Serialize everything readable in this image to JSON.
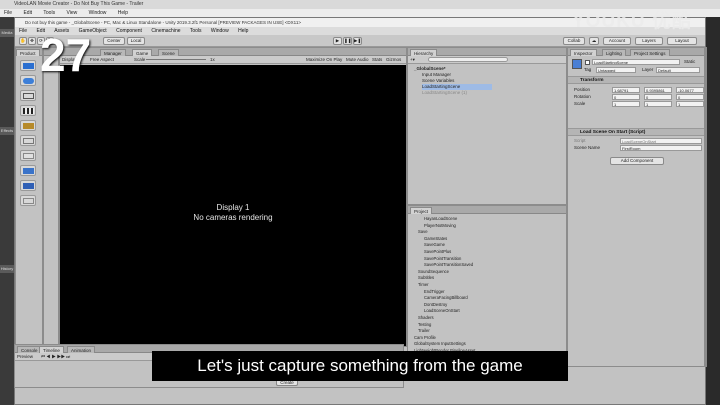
{
  "outer_app": {
    "title": "VideoLAN Movie Creator - Do Not Buy This Game - Trailer",
    "menu": [
      "File",
      "Edit",
      "Tools",
      "View",
      "Window",
      "Help"
    ],
    "left_tabs": [
      "Media",
      "Effects",
      "History"
    ]
  },
  "unity": {
    "title": "Do not buy this game - _GlobalScene - PC, Mac & Linux Standalone - Unity 2019.3.2f1 Personal [PREVIEW PACKAGES IN USE] <DX11>",
    "menu": [
      "File",
      "Edit",
      "Assets",
      "GameObject",
      "Component",
      "Cinemachine",
      "Tools",
      "Window",
      "Help"
    ],
    "toolbar": {
      "pivot_label": "Center",
      "space_label": "Local",
      "collab_label": "Collab",
      "account_label": "Account",
      "layers_label": "Layers",
      "layout_label": "Layout"
    },
    "tabs": {
      "product": "Product",
      "manager": "Manager",
      "game": "Game",
      "scene": "Scene",
      "hierarchy": "Hierarchy",
      "project": "Project",
      "inspector": "Inspector",
      "lighting": "Lighting",
      "project_settings": "Project Settings"
    },
    "game_bar": {
      "display": "Display 1",
      "aspect": "Free Aspect",
      "scale_label": "Scale",
      "scale_value": "1x",
      "maximize": "Maximize On Play",
      "mute": "Mute Audio",
      "stats": "Stats",
      "gizmos": "Gizmos"
    },
    "game_view": {
      "line1": "Display 1",
      "line2": "No cameras rendering"
    },
    "hierarchy": {
      "items": [
        "_GlobalScene*",
        "Input Manager",
        "Scene Variables",
        "LoadStartingScene",
        "LoadStartingScene (1)"
      ]
    },
    "project": {
      "items": [
        "HayanLoadScene",
        "PlayerNotMoving",
        "Save",
        "GameStates",
        "SaveGame",
        "SavePointPlus",
        "SavePointTransition",
        "SavePointTransitionSaved",
        "SoundSequence",
        "Subtitles",
        "Timer",
        "EndTrigger",
        "CameraFacingBillboard",
        "DontDestroy",
        "LoadSceneOnStart",
        "Shaders",
        "Testing",
        "Trailer",
        "Cam Profile",
        "GlobalSystem InputSettings",
        "LightweightRender PipelineAsset",
        "New HDRender PipelineAsset"
      ]
    },
    "inspector": {
      "object_name": "LoadStartingScene",
      "static_label": "Static",
      "tag_label": "Tag",
      "tag_value": "Untagged",
      "layer_label": "Layer",
      "layer_value": "Default",
      "transform_title": "Transform",
      "position_label": "Position",
      "position": {
        "x": "1.68791",
        "y": "0.9395861",
        "z": "-10.0677"
      },
      "rotation_label": "Rotation",
      "rotation": {
        "x": "0",
        "y": "0",
        "z": "0"
      },
      "scale_label": "Scale",
      "scale": {
        "x": "1",
        "y": "1",
        "z": "1"
      },
      "script_title": "Load Scene On Start (Script)",
      "script_label": "Script",
      "script_value": "LoadSceneOnStart",
      "scene_name_label": "Scene Name",
      "scene_name_value": "FirstRoom",
      "add_component": "Add Component"
    },
    "console": {
      "tabs": [
        "Console",
        "Timeline",
        "Animation"
      ],
      "preview_label": "Preview",
      "create": "Create"
    }
  },
  "overlay": {
    "episode_number": "27",
    "watermark": "YOUKU 优酷",
    "subtitle": "Let's just capture something from the game"
  },
  "colors": {
    "game_view_bg": "#000000",
    "panel_bg": "#c2c2c2",
    "subtitle_bg": "#000000",
    "subtitle_text": "#ffffff"
  }
}
